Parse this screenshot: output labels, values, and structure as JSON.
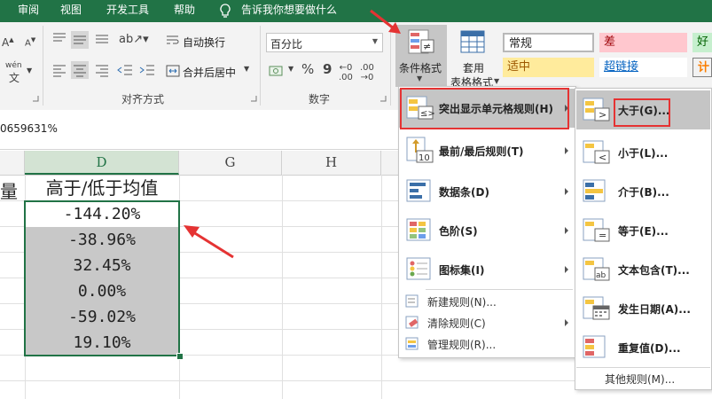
{
  "menubar": {
    "items": [
      "审阅",
      "视图",
      "开发工具",
      "帮助"
    ],
    "tell_me": "告诉我你想要做什么"
  },
  "ribbon": {
    "wrap_text": "自动换行",
    "merge_center": "合并后居中",
    "align_group": "对齐方式",
    "number_format": "百分比",
    "number_group": "数字",
    "percent_symbol": "%",
    "comma_symbol": "9",
    "cond_format_line1": "条件格式",
    "table_format_line1": "套用",
    "table_format_line2": "表格格式",
    "styles": {
      "normal": "常规",
      "bad": "差",
      "good": "好",
      "neutral": "适中",
      "hyperlink": "超链接",
      "calc": "计"
    },
    "font_hint": "wén"
  },
  "formula_bar": {
    "value": "0659631%"
  },
  "columns": [
    "D",
    "G",
    "H"
  ],
  "sheet": {
    "left_partial": "量",
    "header": "高于/低于均值",
    "values": [
      "-144.20%",
      "-38.96%",
      "32.45%",
      "0.00%",
      "-59.02%",
      "19.10%"
    ]
  },
  "cf_menu": {
    "items": [
      {
        "label": "突出显示单元格规则(H)",
        "has_sub": true
      },
      {
        "label": "最前/最后规则(T)",
        "has_sub": true
      },
      {
        "label": "数据条(D)",
        "has_sub": true
      },
      {
        "label": "色阶(S)",
        "has_sub": true
      },
      {
        "label": "图标集(I)",
        "has_sub": true
      }
    ],
    "small_items": [
      {
        "label": "新建规则(N)...",
        "has_sub": false
      },
      {
        "label": "清除规则(C)",
        "has_sub": true
      },
      {
        "label": "管理规则(R)...",
        "has_sub": false
      }
    ]
  },
  "highlight_submenu": {
    "items": [
      "大于(G)...",
      "小于(L)...",
      "介于(B)...",
      "等于(E)...",
      "文本包含(T)...",
      "发生日期(A)...",
      "重复值(D)..."
    ],
    "more": "其他规则(M)..."
  },
  "colors": {
    "title_green": "#217346",
    "annotation_red": "#e53333",
    "selection_green": "#217346",
    "selected_fill": "#c8c8c8"
  }
}
